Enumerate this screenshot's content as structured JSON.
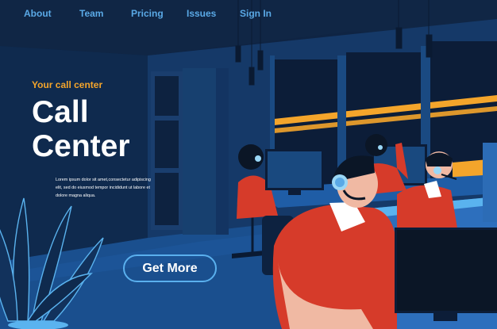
{
  "nav": {
    "about": "About",
    "team": "Team",
    "pricing": "Pricing",
    "issues": "Issues",
    "sign_in": "Sign In"
  },
  "hero": {
    "tagline": "Your call center",
    "title_line1": "Call",
    "title_line2": "Center",
    "description": "Lorem ipsum dolor sit amet,consectetur adipiscing elit, sed do eiusmod tempor incididunt ut labore et dolore magna aliqua."
  },
  "cta": {
    "label": "Get More"
  },
  "colors": {
    "background": "#0f2443",
    "accent": "#f4a52b",
    "nav_link": "#5aa9e6",
    "button_border": "#5ab0ee",
    "shirt": "#d63b2a",
    "monitor_screen": "#19497f"
  }
}
